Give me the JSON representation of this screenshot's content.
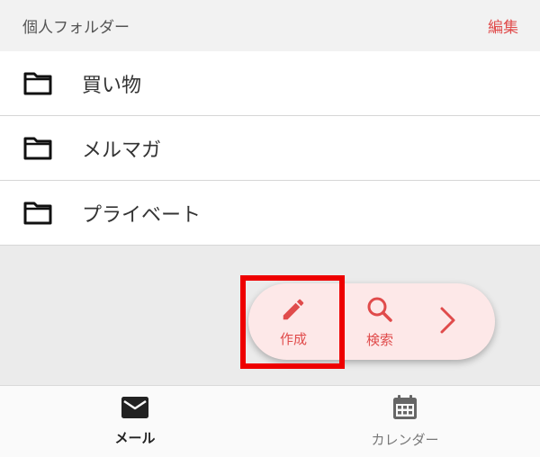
{
  "header": {
    "title": "個人フォルダー",
    "edit_label": "編集"
  },
  "folders": [
    {
      "label": "買い物",
      "icon": "folder-icon"
    },
    {
      "label": "メルマガ",
      "icon": "folder-icon"
    },
    {
      "label": "プライベート",
      "icon": "folder-icon"
    }
  ],
  "fab": {
    "compose_label": "作成",
    "search_label": "検索",
    "accent_color": "#e04b4b",
    "background_color": "#fde8e8"
  },
  "tabs": {
    "mail_label": "メール",
    "calendar_label": "カレンダー",
    "active": "mail"
  },
  "highlight_color": "#ee0000"
}
